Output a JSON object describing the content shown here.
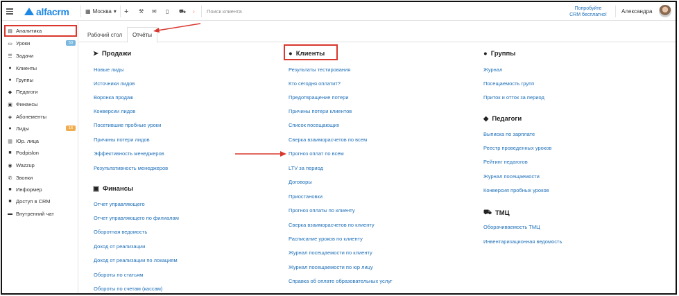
{
  "topbar": {
    "logo": "alfacrm",
    "city": "Москва",
    "search_placeholder": "Поиск клиента",
    "try_line1": "Попробуйте",
    "try_line2": "CRM бесплатно!",
    "user_name": "Александра"
  },
  "sidebar": {
    "items": [
      {
        "label": "Аналитика"
      },
      {
        "label": "Уроки",
        "badge": "53",
        "badge_color": "#7ab8e0"
      },
      {
        "label": "Задачи"
      },
      {
        "label": "Клиенты"
      },
      {
        "label": "Группы"
      },
      {
        "label": "Педагоги"
      },
      {
        "label": "Финансы"
      },
      {
        "label": "Абонементы"
      },
      {
        "label": "Лиды",
        "badge": "16",
        "badge_color": "#f0ad4e"
      },
      {
        "label": "Юр. лица"
      },
      {
        "label": "Podpislon"
      },
      {
        "label": "Wazzup"
      },
      {
        "label": "Звонки"
      },
      {
        "label": "Информер"
      },
      {
        "label": "Доступ в CRM"
      },
      {
        "label": "Внутренний чат"
      }
    ]
  },
  "tabs": [
    "Рабочий стол",
    "Отчёты"
  ],
  "sections": {
    "sales": {
      "title": "Продажи",
      "links": [
        "Новые лиды",
        "Источники лидов",
        "Воронка продаж",
        "Конверсии лидов",
        "Посетившие пробные уроки",
        "Причины потери лидов",
        "Эффективность менеджеров",
        "Результативность менеджеров"
      ]
    },
    "finance": {
      "title": "Финансы",
      "links": [
        "Отчет управляющего",
        "Отчет управляющего по филиалам",
        "Оборотная ведомость",
        "Доход от реализации",
        "Доход от реализации по локациям",
        "Обороты по статьям",
        "Обороты по счетам (кассам)"
      ]
    },
    "clients": {
      "title": "Клиенты",
      "links": [
        "Результаты тестирования",
        "Кто сегодня оплатит?",
        "Предотвращение потери",
        "Причины потери клиентов",
        "Список посещающих",
        "Сверка взаиморасчетов по всем",
        "Прогноз оплат по всем",
        "LTV за период",
        "Договоры",
        "Приостановки",
        "Прогноз оплаты по клиенту",
        "Сверка взаиморасчетов по клиенту",
        "Расписание уроков по клиенту",
        "Журнал посещаемости по клиенту",
        "Журнал посещаемости по юр лицу",
        "Справка об оплате образовательных услуг"
      ]
    },
    "groups": {
      "title": "Группы",
      "links": [
        "Журнал",
        "Посещаемость групп",
        "Приток и отток за период"
      ]
    },
    "teachers": {
      "title": "Педагоги",
      "links": [
        "Выписка по зарплате",
        "Реестр проведенных уроков",
        "Рейтинг педагогов",
        "Журнал посещаемости",
        "Конверсия пробных уроков"
      ]
    },
    "tmc": {
      "title": "ТМЦ",
      "links": [
        "Оборачиваемость ТМЦ",
        "Инвентаризационная ведомость"
      ]
    }
  }
}
